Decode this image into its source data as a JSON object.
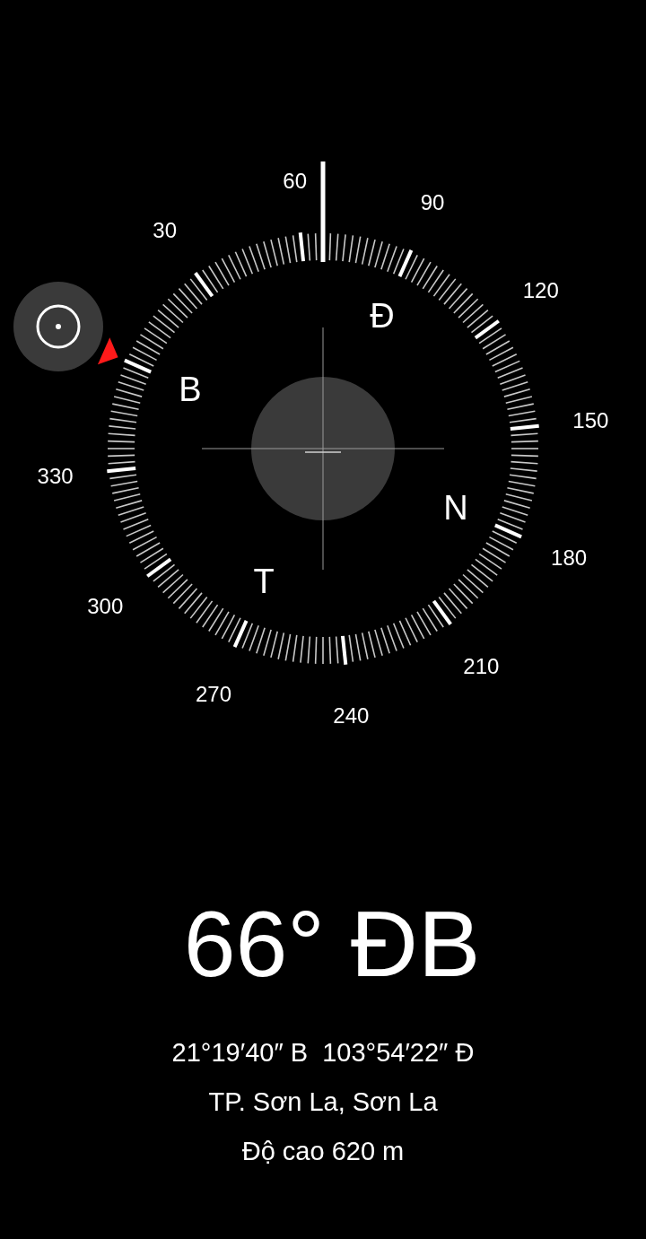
{
  "dial": {
    "degree_labels": [
      "30",
      "60",
      "90",
      "120",
      "150",
      "180",
      "210",
      "240",
      "270",
      "300",
      "330"
    ],
    "cardinal_labels": [
      "B",
      "Đ",
      "N",
      "T"
    ]
  },
  "heading": "66° ĐB",
  "coordinates": "21°19′40″ B  103°54′22″ Đ",
  "location": "TP. Sơn La, Sơn La",
  "altitude": "Độ cao 620 m"
}
